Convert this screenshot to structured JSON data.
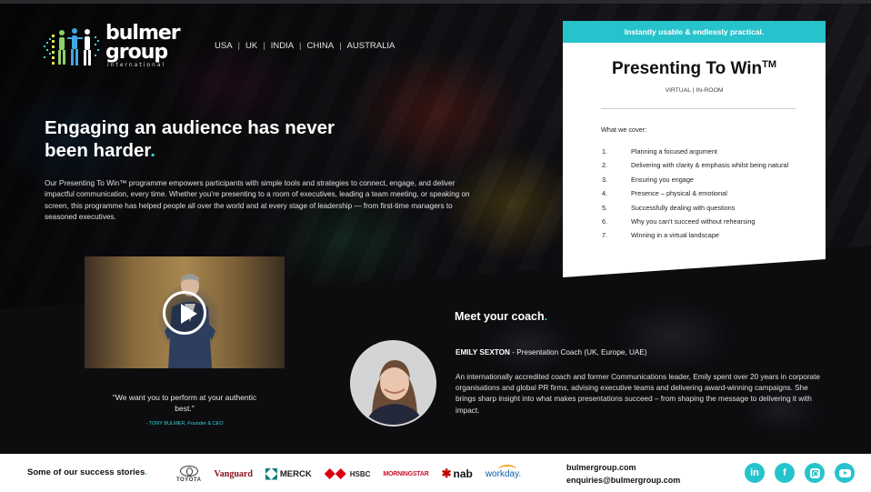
{
  "brand": {
    "name_line1": "bulmer",
    "name_line2": "group",
    "name_line3": "international",
    "accent_color": "#27c3cc"
  },
  "nav": {
    "countries": [
      "USA",
      "UK",
      "INDIA",
      "CHINA",
      "AUSTRALIA"
    ],
    "separator": "|"
  },
  "hero": {
    "title": "Engaging an audience has never been harder",
    "title_dot": ".",
    "body": "Our Presenting To Win™ programme empowers participants with simple tools and strategies to connect, engage, and deliver impactful communication, every time. Whether you're presenting to a room of executives, leading a team meeting, or speaking on screen, this programme has helped people all over the world and at every stage of leadership — from first-time managers to seasoned executives."
  },
  "video": {
    "play_icon": "play-icon"
  },
  "quote": {
    "text": "\"We want you to perform at your authentic best.\"",
    "author": "- TONY BULMER, Founder & CEO"
  },
  "card": {
    "banner": "Instantly usable & endlessly practical.",
    "title": "Presenting To Win",
    "title_tm": "TM",
    "subtitle": "VIRTUAL  |  IN-ROOM",
    "cover_heading": "What we cover:",
    "items": [
      {
        "num": "1.",
        "text": "Planning a focused argument"
      },
      {
        "num": "2.",
        "text": "Delivering with clarity & emphasis whilst being natural"
      },
      {
        "num": "3.",
        "text": "Ensuring you engage"
      },
      {
        "num": "4.",
        "text": "Presence – physical & emotional"
      },
      {
        "num": "5.",
        "text": "Successfully dealing with questions"
      },
      {
        "num": "6.",
        "text": "Why you can't succeed without rehearsing"
      },
      {
        "num": "7.",
        "text": "Winning in a virtual landscape"
      }
    ]
  },
  "coach": {
    "heading": "Meet your coach",
    "heading_dot": ".",
    "name": "EMILY SEXTON",
    "role": " - Presentation Coach (UK, Europe, UAE)",
    "bio": "An internationally accredited coach and former Communications leader, Emily spent over 20 years in corporate organisations and global PR firms, advising executive teams and delivering award-winning campaigns. She brings sharp insight into what makes presentations succeed – from shaping the message to delivering it with impact."
  },
  "footer": {
    "stories_label": "Some of our success stories",
    "stories_dot": ".",
    "clients": {
      "toyota": "TOYOTA",
      "vanguard": "Vanguard",
      "merck": "MERCK",
      "hsbc": "HSBC",
      "morningstar": "MORNINGSTAR",
      "nab": "nab",
      "workday": "workday."
    },
    "website": "bulmergroup.com",
    "email": "enquiries@bulmergroup.com",
    "socials": {
      "linkedin": "in",
      "facebook": "f"
    }
  }
}
